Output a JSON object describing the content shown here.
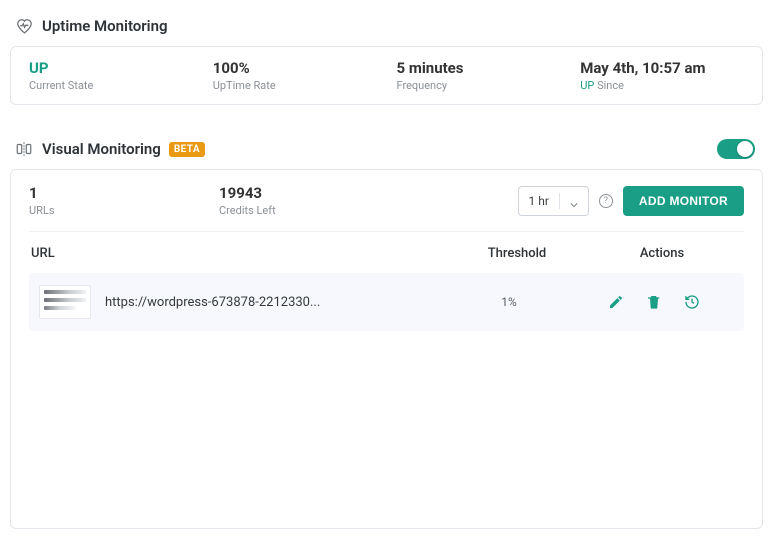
{
  "uptime": {
    "title": "Uptime Monitoring",
    "state_value": "UP",
    "state_label": "Current State",
    "rate_value": "100%",
    "rate_label": "UpTime Rate",
    "frequency_value": "5 minutes",
    "frequency_label": "Frequency",
    "since_value": "May 4th, 10:57 am",
    "since_prefix": "UP",
    "since_label": "Since"
  },
  "visual": {
    "title": "Visual Monitoring",
    "beta": "BETA",
    "urls_count": "1",
    "urls_label": "URLs",
    "credits_value": "19943",
    "credits_label": "Credits Left",
    "frequency_selected": "1 hr",
    "add_button": "ADD MONITOR",
    "columns": {
      "url": "URL",
      "threshold": "Threshold",
      "actions": "Actions"
    },
    "row": {
      "url": "https://wordpress-673878-2212330...",
      "threshold": "1%"
    }
  }
}
